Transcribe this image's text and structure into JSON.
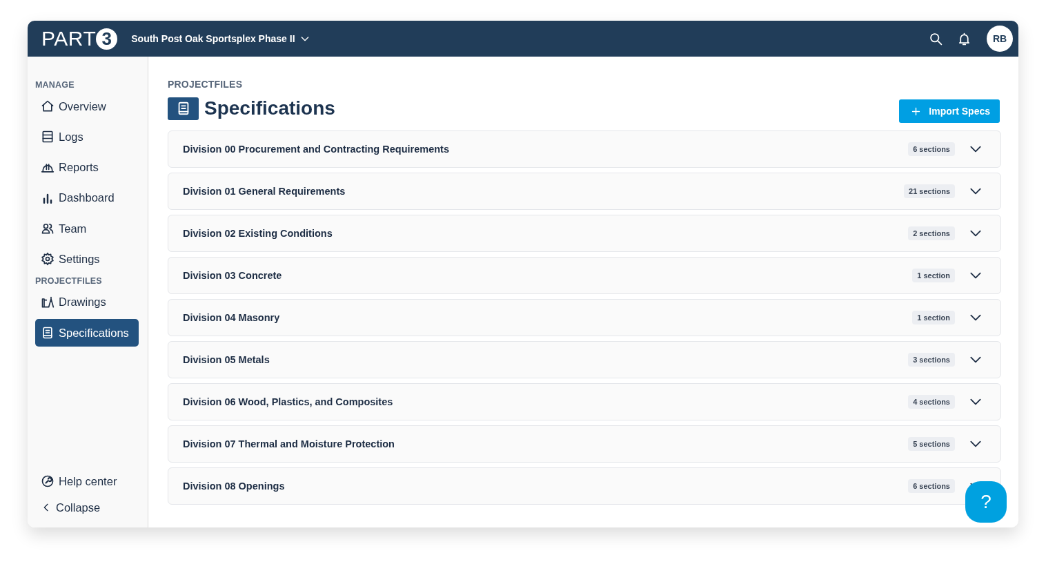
{
  "header": {
    "logo": {
      "word": "PART",
      "mark": "3"
    },
    "project": "South Post Oak Sportsplex Phase II",
    "avatar": "RB"
  },
  "sidebar": {
    "groups": [
      {
        "heading": "MANAGE",
        "items": [
          {
            "label": "Overview",
            "kind": "home",
            "selected": false
          },
          {
            "label": "Logs",
            "kind": "logs",
            "selected": false
          },
          {
            "label": "Reports",
            "kind": "helmet",
            "selected": false
          },
          {
            "label": "Dashboard",
            "kind": "bars",
            "selected": false
          },
          {
            "label": "Team",
            "kind": "team",
            "selected": false
          },
          {
            "label": "Settings",
            "kind": "gear",
            "selected": false
          }
        ]
      },
      {
        "heading": "PROJECTFILES",
        "items": [
          {
            "label": "Drawings",
            "kind": "drawing",
            "selected": false
          },
          {
            "label": "Specifications",
            "kind": "book",
            "selected": true
          }
        ]
      }
    ],
    "footer": [
      {
        "label": "Help center",
        "kind": "help"
      },
      {
        "label": "Collapse",
        "kind": "chevron"
      }
    ]
  },
  "page": {
    "breadcrumb": "PROJECTFILES",
    "title": "Specifications",
    "action": "Import Specs"
  },
  "divisions": [
    {
      "title": "Division 00 Procurement and Contracting Requirements",
      "count": "6 sections",
      "expanded": false
    },
    {
      "title": "Division 01 General Requirements",
      "count": "21 sections",
      "expanded": false
    },
    {
      "title": "Division 02 Existing Conditions",
      "count": "2 sections",
      "expanded": false
    },
    {
      "title": "Division 03 Concrete",
      "count": "1 section",
      "expanded": false
    },
    {
      "title": "Division 04 Masonry",
      "count": "1 section",
      "expanded": false
    },
    {
      "title": "Division 05 Metals",
      "count": "3 sections",
      "expanded": false
    },
    {
      "title": "Division 06 Wood, Plastics, and Composites",
      "count": "4 sections",
      "expanded": false
    },
    {
      "title": "Division 07 Thermal and Moisture Protection",
      "count": "5 sections",
      "expanded": false
    },
    {
      "title": "Division 08 Openings",
      "count": "6 sections",
      "expanded": false
    }
  ],
  "help_button": "?"
}
